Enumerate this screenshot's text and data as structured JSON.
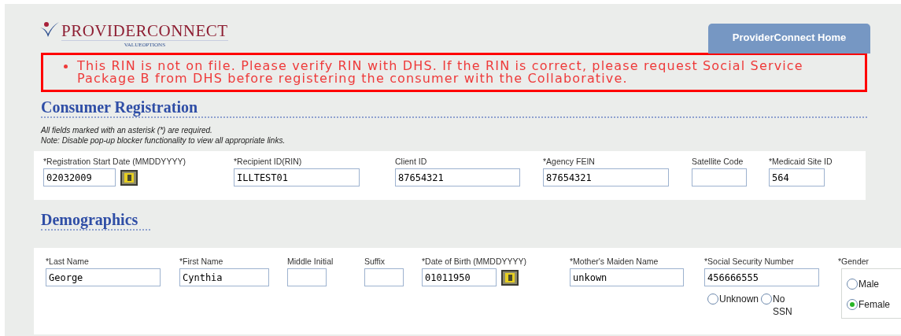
{
  "header": {
    "logo_title": "PROVIDERCONNECT",
    "logo_subtitle": "VALUEOPTIONS",
    "home_button": "ProviderConnect Home"
  },
  "error_messages": [
    "This RIN is not on file. Please verify RIN with DHS. If the RIN is correct, please request Social Service Package B from DHS before registering the consumer with the Collaborative."
  ],
  "consumer_registration": {
    "title": "Consumer Registration",
    "notes": [
      "All fields marked with an asterisk (*) are required.",
      "Note: Disable pop-up blocker functionality to view all appropriate links."
    ],
    "fields": [
      {
        "kind": "date",
        "label": "*Registration Start Date (MMDDYYYY)",
        "value": "02032009"
      },
      {
        "kind": "text",
        "label": "*Recipient ID(RIN)",
        "value": "ILLTEST01"
      },
      {
        "kind": "text",
        "label": "Client ID",
        "value": "87654321"
      },
      {
        "kind": "text",
        "label": "*Agency FEIN",
        "value": "87654321"
      },
      {
        "kind": "text",
        "label": "Satellite Code"
      },
      {
        "kind": "text",
        "label": "*Medicaid Site ID",
        "value": "564"
      }
    ]
  },
  "demographics": {
    "title": "Demographics",
    "fields": [
      {
        "kind": "text",
        "label": "*Last Name",
        "value": "George"
      },
      {
        "kind": "text",
        "label": "*First Name",
        "value": "Cynthia"
      },
      {
        "kind": "text",
        "label": "Middle Initial"
      },
      {
        "kind": "text",
        "label": "Suffix"
      },
      {
        "kind": "date",
        "label": "*Date of Birth (MMDDYYYY)",
        "value": "01011950"
      },
      {
        "kind": "text",
        "label": "*Mother's Maiden Name",
        "value": "unkown"
      },
      {
        "kind": "ssn",
        "label": "*Social Security Number",
        "value": "456666555",
        "options": [
          {
            "label": "Unknown",
            "selected": false
          },
          {
            "label": "No SSN",
            "selected": false
          }
        ]
      },
      {
        "kind": "radio",
        "label": "*Gender",
        "options": [
          {
            "label": "Male",
            "selected": false
          },
          {
            "label": "Female",
            "selected": true
          }
        ]
      }
    ]
  }
}
